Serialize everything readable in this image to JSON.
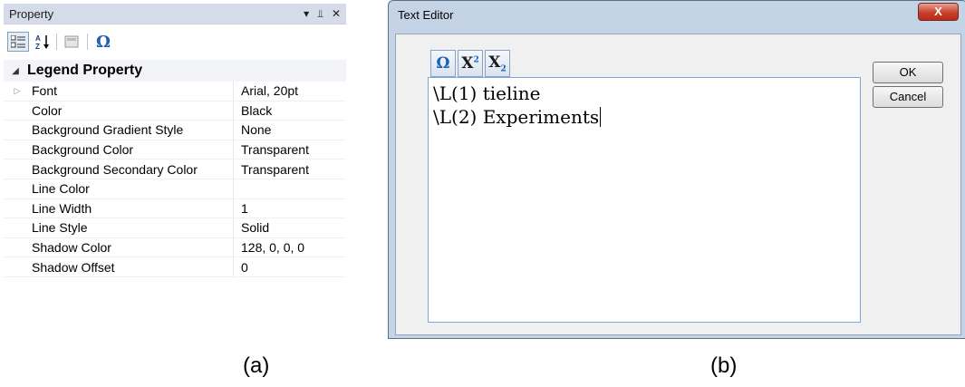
{
  "property_panel": {
    "title": "Property",
    "header_icons": [
      "▾",
      "ᵖ",
      "✕"
    ],
    "category": "Legend Property",
    "properties": [
      {
        "name": "Font",
        "value": "Arial, 20pt"
      },
      {
        "name": "Color",
        "value": "Black"
      },
      {
        "name": "Background Gradient Style",
        "value": "None"
      },
      {
        "name": "Background Color",
        "value": "Transparent"
      },
      {
        "name": "Background Secondary Color",
        "value": "Transparent"
      },
      {
        "name": "Line Color",
        "value": ""
      },
      {
        "name": "Line Width",
        "value": "1"
      },
      {
        "name": "Line Style",
        "value": "Solid"
      },
      {
        "name": "Shadow Color",
        "value": "128, 0, 0, 0"
      },
      {
        "name": "Shadow Offset",
        "value": "0"
      }
    ],
    "omega": "Ω",
    "az_label": "A Z"
  },
  "text_editor": {
    "title": "Text Editor",
    "close": "X",
    "format_buttons": {
      "omega": "Ω",
      "superscript_base": "X",
      "superscript_exp": "2",
      "subscript_base": "X",
      "subscript_exp": "2"
    },
    "lines": [
      "\\L(1) tieline",
      "\\L(2) Experiments"
    ],
    "ok_label": "OK",
    "cancel_label": "Cancel"
  },
  "captions": {
    "a": "(a)",
    "b": "(b)"
  }
}
